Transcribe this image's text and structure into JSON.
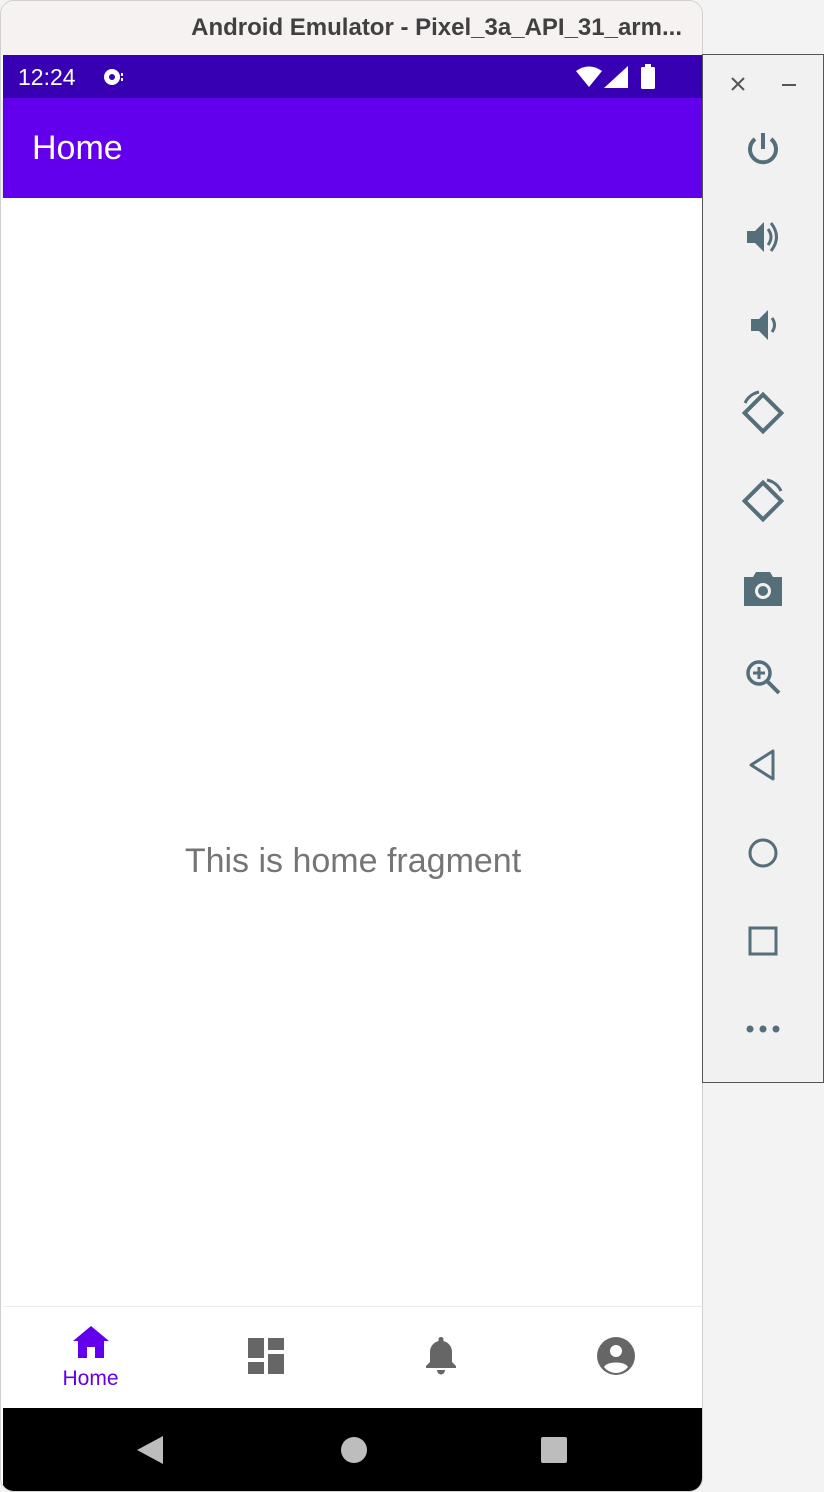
{
  "window": {
    "title": "Android Emulator - Pixel_3a_API_31_arm..."
  },
  "status_bar": {
    "time": "12:24"
  },
  "app_bar": {
    "title": "Home"
  },
  "content": {
    "message": "This is home fragment"
  },
  "bottom_nav": {
    "items": [
      {
        "label": "Home",
        "icon": "home-icon",
        "selected": true
      },
      {
        "label": "",
        "icon": "dashboard-icon",
        "selected": false
      },
      {
        "label": "",
        "icon": "notifications-icon",
        "selected": false
      },
      {
        "label": "",
        "icon": "account-icon",
        "selected": false
      }
    ]
  },
  "system_nav": {
    "buttons": [
      "back-icon",
      "home-circle-icon",
      "recents-icon"
    ]
  },
  "emulator_panel": {
    "tools": [
      "power-icon",
      "volume-up-icon",
      "volume-down-icon",
      "rotate-left-icon",
      "rotate-right-icon",
      "camera-icon",
      "zoom-icon",
      "back-icon",
      "home-icon",
      "overview-icon",
      "more-icon"
    ]
  },
  "colors": {
    "primary": "#6200ee",
    "primary_dark": "#3700b3",
    "content_text": "#757575",
    "panel_icon": "#546e7a"
  }
}
